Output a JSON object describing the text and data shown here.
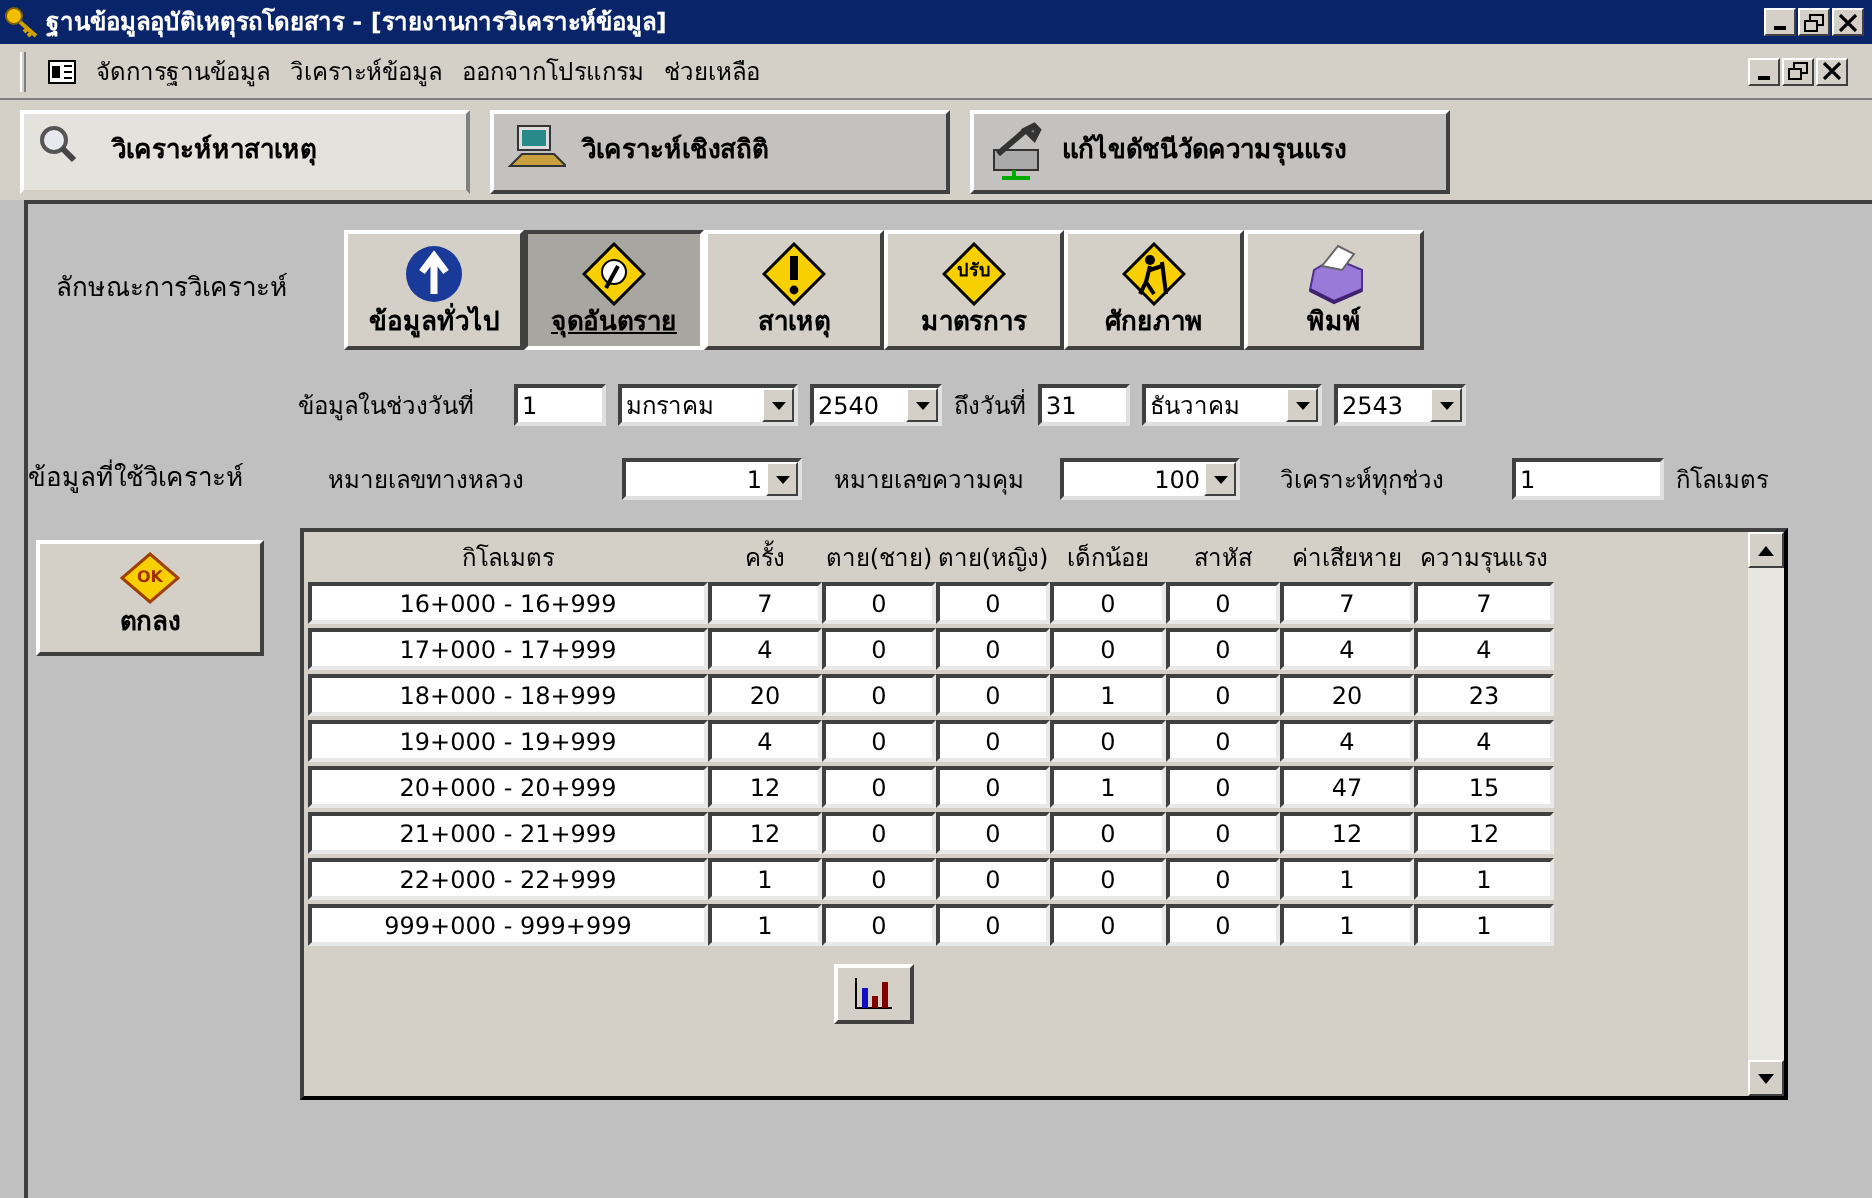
{
  "window": {
    "title": "ฐานข้อมูลอุบัติเหตุรถโดยสาร - [รายงานการวิเคราะห์ข้อมูล]"
  },
  "menu": [
    "จัดการฐานข้อมูล",
    "วิเคราะห์ข้อมูล",
    "ออกจากโปรแกรม",
    "ช่วยเหลือ"
  ],
  "tabs": [
    {
      "label": "วิเคราะห์หาสาเหตุ",
      "kind": "magnifier",
      "selected": true
    },
    {
      "label": "วิเคราะห์เชิงสถิติ",
      "kind": "computer",
      "selected": false
    },
    {
      "label": "แก้ไขดัชนีวัดความรุนแรง",
      "kind": "tools",
      "selected": false
    }
  ],
  "analysis_type": {
    "label": "ลักษณะการวิเคราะห์",
    "buttons": [
      {
        "label": "ข้อมูลทั่วไป",
        "kind": "info",
        "selected": false
      },
      {
        "label": "จุดอันตราย",
        "kind": "hazard",
        "selected": true
      },
      {
        "label": "สาเหตุ",
        "kind": "warning",
        "selected": false
      },
      {
        "label": "มาตรการ",
        "kind": "sign",
        "icon_text": "ปรับ",
        "selected": false
      },
      {
        "label": "ศักยภาพ",
        "kind": "worker",
        "selected": false
      },
      {
        "label": "พิมพ์",
        "kind": "printer",
        "selected": false
      }
    ]
  },
  "date_range": {
    "label": "ข้อมูลในช่วงวันที่",
    "from_day": "1",
    "from_month": "มกราคม",
    "from_year": "2540",
    "to_label": "ถึงวันที่",
    "to_day": "31",
    "to_month": "ธันวาคม",
    "to_year": "2543"
  },
  "data_used": {
    "label": "ข้อมูลที่ใช้วิเคราะห์",
    "highway_label": "หมายเลขทางหลวง",
    "highway": "1",
    "control_label": "หมายเลขความคุม",
    "control": "100",
    "interval_label": "วิเคราะห์ทุกช่วง",
    "interval": "1",
    "unit": "กิโลเมตร"
  },
  "ok_button": {
    "label": "ตกลง",
    "icon_text": "OK"
  },
  "table": {
    "columns": [
      "กิโลเมตร",
      "ครั้ง",
      "ตาย(ชาย)",
      "ตาย(หญิง)",
      "เด็กน้อย",
      "สาหัส",
      "ค่าเสียหาย",
      "ความรุนแรง"
    ],
    "rows": [
      [
        "16+000 - 16+999",
        "7",
        "0",
        "0",
        "0",
        "0",
        "7",
        "7"
      ],
      [
        "17+000 - 17+999",
        "4",
        "0",
        "0",
        "0",
        "0",
        "4",
        "4"
      ],
      [
        "18+000 - 18+999",
        "20",
        "0",
        "0",
        "1",
        "0",
        "20",
        "23"
      ],
      [
        "19+000 - 19+999",
        "4",
        "0",
        "0",
        "0",
        "0",
        "4",
        "4"
      ],
      [
        "20+000 - 20+999",
        "12",
        "0",
        "0",
        "1",
        "0",
        "47",
        "15"
      ],
      [
        "21+000 - 21+999",
        "12",
        "0",
        "0",
        "0",
        "0",
        "12",
        "12"
      ],
      [
        "22+000 - 22+999",
        "1",
        "0",
        "0",
        "0",
        "0",
        "1",
        "1"
      ],
      [
        "999+000 - 999+999",
        "1",
        "0",
        "0",
        "0",
        "0",
        "1",
        "1"
      ]
    ]
  }
}
